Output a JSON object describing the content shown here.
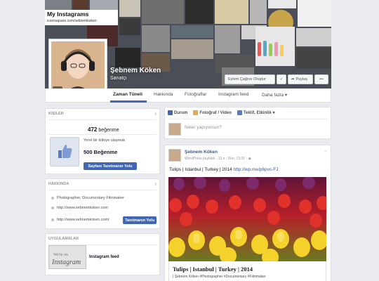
{
  "cover": {
    "title": "My Instagrams",
    "url": "iconosquare.com/sebnemkoken",
    "name": "Şebnem Köken",
    "subtitle": "Sanatçı",
    "btn_cta": "Eylem Çağrısı Oluştur",
    "btn_like": "✓",
    "btn_share": "Paylaş",
    "btn_more": "•••"
  },
  "tabs": [
    {
      "label": "Zaman Tüneli"
    },
    {
      "label": "Hakkında"
    },
    {
      "label": "Fotoğraflar"
    },
    {
      "label": "Instagram feed"
    },
    {
      "label": "Daha fazla ▾"
    }
  ],
  "people": {
    "heading": "KİŞİLER",
    "likes_count": "472",
    "likes_word": "beğenme",
    "reach_text_1": "Yerel bir kitleye ulaşmak",
    "reach_text_2": "için sayfanızı tanıtın",
    "reach_big": "500 Beğenme",
    "promote_btn": "Sayfanı Tanıtmanın Yolu",
    "promote_btn_exact": "Sayfanı Tanıtmanın Yolu"
  },
  "about": {
    "heading": "HAKKINDA",
    "line1": "Photographer, Documentary Filmmaker",
    "line2": "http://www.sebnemkoken.com",
    "line3": "http://www.sebnemkoken.com/",
    "promote_btn": "Tanıtmanın Yolu"
  },
  "apps": {
    "heading": "UYGULAMALAR",
    "thumb_text": "Instagram",
    "app_name": "Instagram feed"
  },
  "composer": {
    "tab_status": "Durum",
    "tab_photo": "Fotoğraf / Video",
    "tab_offer": "Teklif, Etkinlik ▾",
    "placeholder": "Neler yapıyorsun?"
  },
  "post": {
    "author": "Şebnem Köken",
    "meta": "WordPress paylaştı · 13 s · Dün, 13:31 · ",
    "text_prefix": "Tulips | Istanbul | Turkey | 2014 ",
    "text_link": "http://wp.me/p6pvc-FJ",
    "caption_title": "Tulips | Istanbul | Turkey | 2014",
    "caption_sub": "| Şebnem Köken #Photographer #Documentary #Filmmaker"
  },
  "colors": {
    "accent": "#4267b2",
    "link": "#365899",
    "bg": "#e9ebee"
  }
}
